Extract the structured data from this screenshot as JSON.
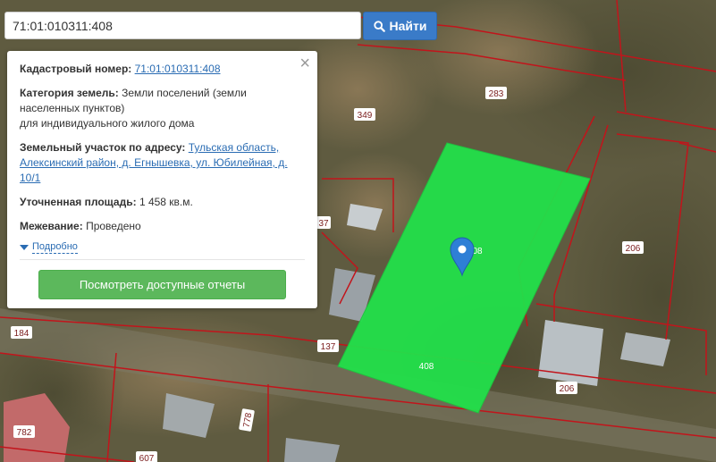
{
  "search": {
    "value": "71:01:010311:408",
    "button_label": "Найти"
  },
  "info": {
    "cad_label": "Кадастровый номер:",
    "cad_value": "71:01:010311:408",
    "category_label": "Категория земель:",
    "category_line1": "Земли поселений (земли",
    "category_line2": "населенных пунктов)",
    "category_line3": "для индивидуального жилого дома",
    "address_label": "Земельный участок по адресу:",
    "address_line1": "Тульская область,",
    "address_line2": "Алексинский район, д. Егнышевка, ул. Юбилейная, д.",
    "address_line3": "10/1",
    "area_label": "Уточненная площадь:",
    "area_value": "1 458 кв.м.",
    "survey_label": "Межевание:",
    "survey_value": "Проведено",
    "more_link": "Подробно",
    "report_button": "Посмотреть доступные отчеты"
  },
  "map": {
    "parcel_labels": {
      "p283": "283",
      "p349": "349",
      "p37": "37",
      "p408a": "08",
      "p206a": "206",
      "p137": "137",
      "p408b": "408",
      "p206b": "206",
      "p184": "184",
      "p782": "782",
      "p778": "778",
      "p607": "607"
    },
    "colors": {
      "selected_parcel": "#22e04a",
      "boundary": "#c2141b",
      "marker": "#2e7fd6"
    }
  }
}
